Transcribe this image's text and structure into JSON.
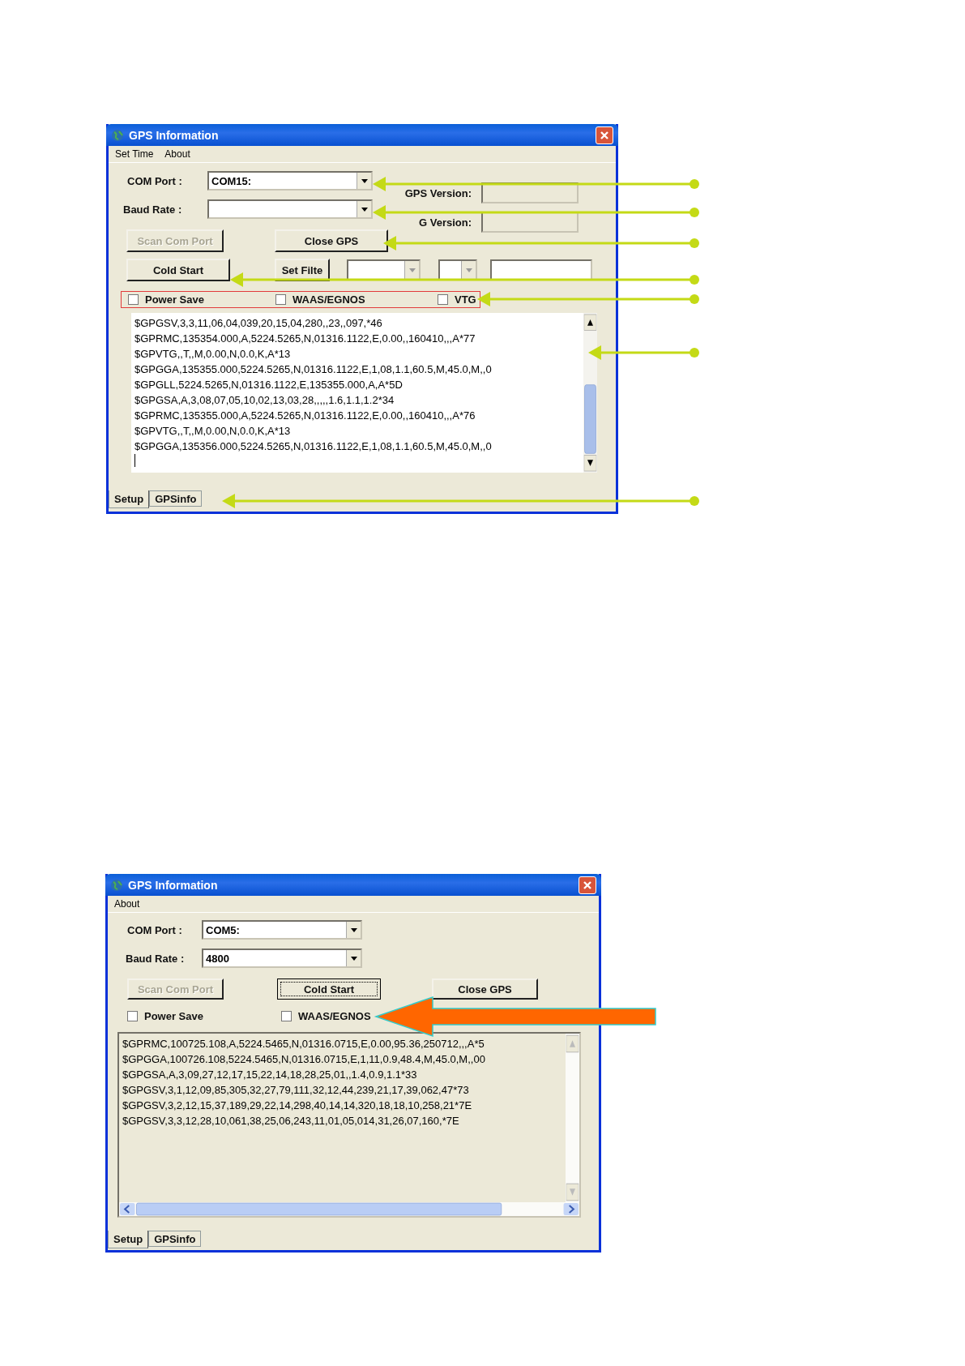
{
  "window_1": {
    "title": "GPS Information",
    "menu": [
      "Set Time",
      "About"
    ],
    "com_port": {
      "label": "COM Port :",
      "value": "COM15:"
    },
    "baud_rate": {
      "label": "Baud Rate :"
    },
    "versions": [
      {
        "label": "GPS Version:"
      },
      {
        "label": "G Version:"
      }
    ],
    "scan_button": {
      "label": "Scan Com Port",
      "disabled": true
    },
    "close_button": {
      "label": "Close GPS",
      "disabled": false
    },
    "cold_start_button": {
      "label": "Cold Start",
      "disabled": false
    },
    "filter_button": {
      "label": "Set Filte",
      "disabled": false
    },
    "options": {
      "highlighted": true,
      "items": [
        {
          "label": "Power Save",
          "checked": false
        },
        {
          "label": "WAAS/EGNOS",
          "checked": false
        },
        {
          "label": "VTG",
          "checked": false
        }
      ]
    },
    "log": {
      "read_only": false,
      "lines": [
        "$GPGSV,3,3,11,06,04,039,20,15,04,280,,23,,097,*46",
        "$GPRMC,135354.000,A,5224.5265,N,01316.1122,E,0.00,,160410,,,A*77",
        "$GPVTG,,T,,M,0.00,N,0.0,K,A*13",
        "$GPGGA,135355.000,5224.5265,N,01316.1122,E,1,08,1.1,60.5,M,45.0,M,,0",
        "$GPGLL,5224.5265,N,01316.1122,E,135355.000,A,A*5D",
        "$GPGSA,A,3,08,07,05,10,02,13,03,28,,,,,1.6,1.1,1.2*34",
        "$GPRMC,135355.000,A,5224.5265,N,01316.1122,E,0.00,,160410,,,A*76",
        "$GPVTG,,T,,M,0.00,N,0.0,K,A*13",
        "$GPGGA,135356.000,5224.5265,N,01316.1122,E,1,08,1.1,60.5,M,45.0,M,,0"
      ]
    },
    "tabs": [
      {
        "label": "Setup",
        "selected": true
      },
      {
        "label": "GPSinfo",
        "selected": false
      }
    ]
  },
  "window_2": {
    "title": "GPS Information",
    "menu": [
      "About"
    ],
    "com_port": {
      "label": "COM Port :",
      "value": "COM5:"
    },
    "baud_rate": {
      "label": "Baud Rate :",
      "value": "4800"
    },
    "buttons": [
      {
        "label": "Scan Com Port",
        "disabled": true,
        "focused": false
      },
      {
        "label": "Cold Start",
        "disabled": false,
        "focused": true
      },
      {
        "label": "Close GPS",
        "disabled": false,
        "focused": false
      }
    ],
    "options": {
      "highlighted": false,
      "items": [
        {
          "label": "Power Save",
          "checked": false
        },
        {
          "label": "WAAS/EGNOS",
          "checked": false
        }
      ]
    },
    "log": {
      "read_only": true,
      "lines": [
        "$GPRMC,100725.108,A,5224.5465,N,01316.0715,E,0.00,95.36,250712,,,A*5",
        "$GPGGA,100726.108,5224.5465,N,01316.0715,E,1,11,0.9,48.4,M,45.0,M,,00",
        "$GPGSA,A,3,09,27,12,17,15,22,14,18,28,25,01,,1.4,0.9,1.1*33",
        "$GPGSV,3,1,12,09,85,305,32,27,79,111,32,12,44,239,21,17,39,062,47*73",
        "$GPGSV,3,2,12,15,37,189,29,22,14,298,40,14,14,320,18,18,10,258,21*7E",
        "$GPGSV,3,3,12,28,10,061,38,25,06,243,11,01,05,014,31,26,07,160,*7E"
      ]
    },
    "tabs": [
      {
        "label": "Setup",
        "selected": true
      },
      {
        "label": "GPSinfo",
        "selected": false
      }
    ]
  }
}
